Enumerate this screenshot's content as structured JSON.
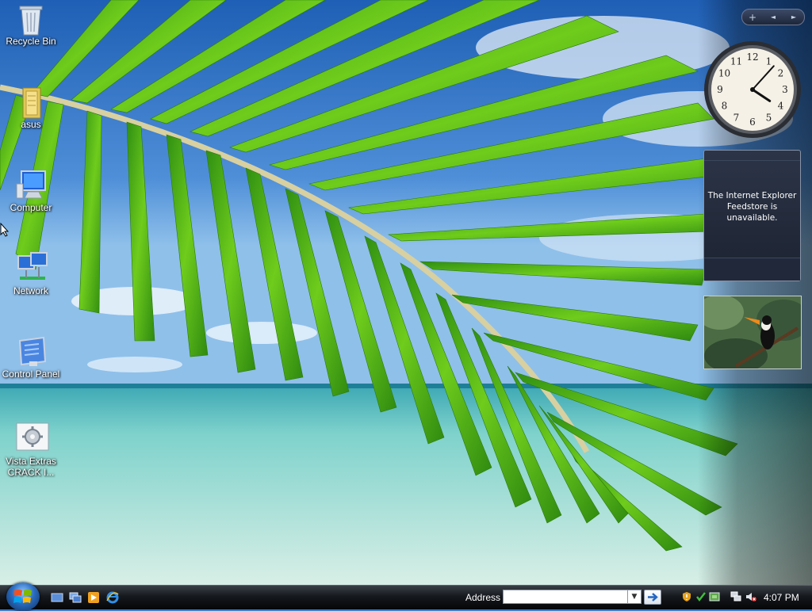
{
  "desktop": {
    "icons": [
      {
        "label": "Recycle Bin",
        "icon": "recycle-bin-icon"
      },
      {
        "label": "asus",
        "icon": "folder-icon"
      },
      {
        "label": "Computer",
        "icon": "computer-icon"
      },
      {
        "label": "Network",
        "icon": "network-icon"
      },
      {
        "label": "Control Panel",
        "icon": "control-panel-icon"
      },
      {
        "label": "Vista Extras CRACK I...",
        "icon": "settings-file-icon"
      }
    ]
  },
  "sidebar": {
    "controls": {
      "add": "+",
      "prev": "◄",
      "next": "►"
    },
    "clock": {
      "numbers": [
        "12",
        "1",
        "2",
        "3",
        "4",
        "5",
        "6",
        "7",
        "8",
        "9",
        "10",
        "11"
      ],
      "hour": 4,
      "minute": 7
    },
    "feed": {
      "message": "The Internet Explorer Feedstore is unavailable."
    },
    "slideshow": {
      "subject": "toucan"
    }
  },
  "taskbar": {
    "address_label": "Address",
    "address_value": "",
    "time": "4:07 PM",
    "tray_icons": [
      "security-alert-icon",
      "tray-app-icon",
      "tray-app2-icon",
      "network-tray-icon",
      "volume-muted-icon"
    ],
    "quick_launch": [
      "show-desktop-icon",
      "switch-windows-icon",
      "media-player-icon",
      "internet-explorer-icon"
    ]
  },
  "colors": {
    "taskbar": "#15181d",
    "sky": "#3a7fd0",
    "sea": "#8fd6cf",
    "leaf": "#5fbf1a"
  }
}
